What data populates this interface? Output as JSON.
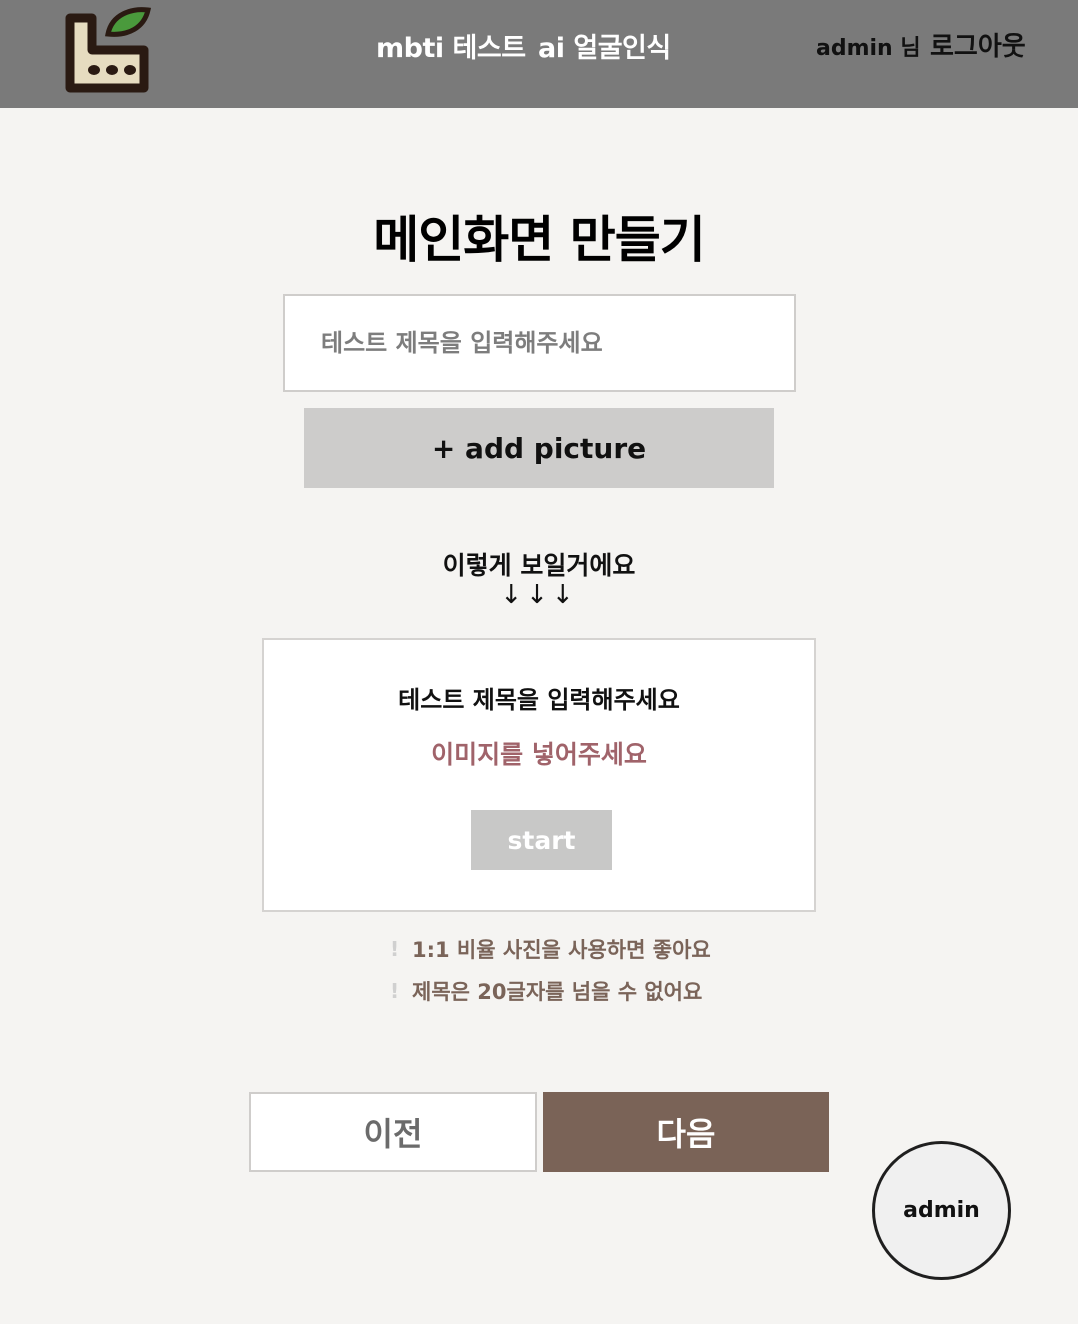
{
  "header": {
    "nav": [
      "mbti 테스트",
      "ai 얼굴인식"
    ],
    "user_name": "admin 님",
    "logout_label": "로그아웃"
  },
  "main": {
    "page_title": "메인화면 만들기",
    "title_input": {
      "value": "",
      "placeholder": "테스트 제목을 입력해주세요"
    },
    "add_picture_label": "+ add picture",
    "preview_label": "이렇게 보일거에요",
    "arrows": "↓↓↓",
    "preview": {
      "title": "테스트 제목을 입력해주세요",
      "image_placeholder": "이미지를 넣어주세요",
      "start_label": "start"
    },
    "notes": [
      "1:1 비율 사진을 사용하면 좋아요",
      "제목은 20글자를 넘을 수 없어요"
    ],
    "note_marker": "!",
    "prev_label": "이전",
    "next_label": "다음"
  },
  "admin_fab_label": "admin",
  "colors": {
    "header_bg": "#7a7a7a",
    "page_bg": "#f5f4f2",
    "accent_brown": "#7a6357",
    "preview_image_text": "#a0636a",
    "logo_leaf": "#4a9a3c"
  },
  "icons": {
    "logo": "leaf-box-logo-icon"
  }
}
